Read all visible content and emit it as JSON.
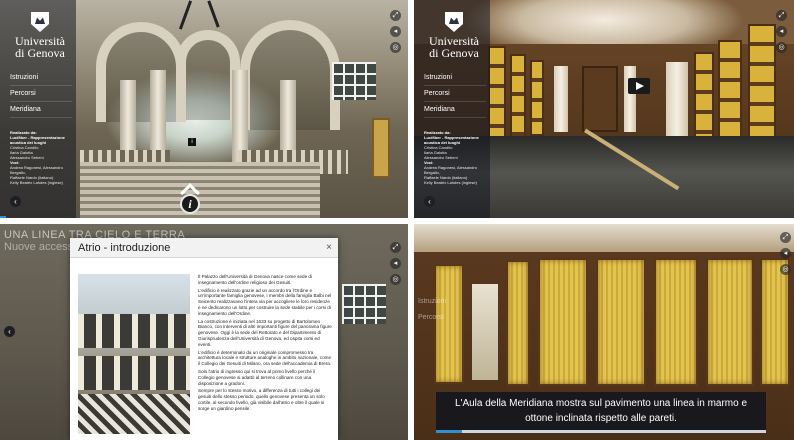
{
  "brand": {
    "logo_line1": "Università",
    "logo_line2": "di Genova"
  },
  "menu": {
    "items": [
      {
        "label": "Istruzioni"
      },
      {
        "label": "Percorsi"
      },
      {
        "label": "Meridiana"
      }
    ]
  },
  "credits": {
    "heading": "Realizzato da:",
    "lines": [
      "Lucifiber - Rappresentazione",
      "acustica dei luoghi",
      "Cristina Candito",
      "Ilaria Galotta",
      "Alessandro Sebeni",
      "Voci:",
      "Andrea Ragonesi, Alessandro Bergallo,",
      "Raffaele Nardo (italiano)",
      "Kelly Beatrix Lahdes (inglese)"
    ]
  },
  "icons": {
    "back": "chevron-left-icon",
    "fullscreen": "fullscreen-icon",
    "audio": "speaker-icon",
    "gyro": "gyroscope-icon",
    "info": "info-icon",
    "play": "play-icon",
    "close": "close-icon"
  },
  "panel3": {
    "bg_title": "UNA LINEA TRA CIELO E TERRA",
    "bg_subtitle": "Nuove accessibilità del Palazzo dell'Università"
  },
  "modal": {
    "title": "Atrio - introduzione",
    "close_label": "×",
    "paragraphs": [
      "Il Palazzo dell'Università di Genova nasce come sede di insegnamento dell'ordine religioso dei Gesuiti.",
      "L'edificio è realizzato grazie ad un accordo tra l'Ordine e un'importante famiglia genovese, i membri della famiglia Balbi nel Seicento realizzavano l'intera via per accogliere le loro residenze e ne dedicarono un lotto per costruire la sede stabile per i corsi di insegnamento dell'Ordine.",
      "La costruzione è iniziata nel 1633 su progetto di Bartolomeo Bianco, con interventi di altri importanti figure del panorama figure genovese. Oggi è la sede del Rettorato e del Dipartimento di Giurisprudenza dell'Università di Genova, ed ospita corsi ed eventi.",
      "L'edificio è determinato da un originale compromesso tra architettura locale e strutture analoghe in ambito nazionale, come il Collegio dei Gesuiti di Milano, ora sede dell'accademia di Brera.",
      "Solo l'atrio di ingresso qui si trova al primo livello perché il Collegio genovese si adattò al terreno collinare con una disposizione a gradoni.",
      "Sempre per lo stesso motivo, a differenza di tutti i collegi dei gesuiti dello stesso periodo, quello genovese presenta un solo cortile, al secondo livello, già visibile dall'atrio e oltre il quale si sorge un giardino pensile."
    ]
  },
  "subtitle": {
    "line1": "L'Aula della Meridiana mostra sul pavimento una linea in marmo e",
    "line2": "ottone inclinata rispetto alle pareti.",
    "progress": 0.08
  }
}
